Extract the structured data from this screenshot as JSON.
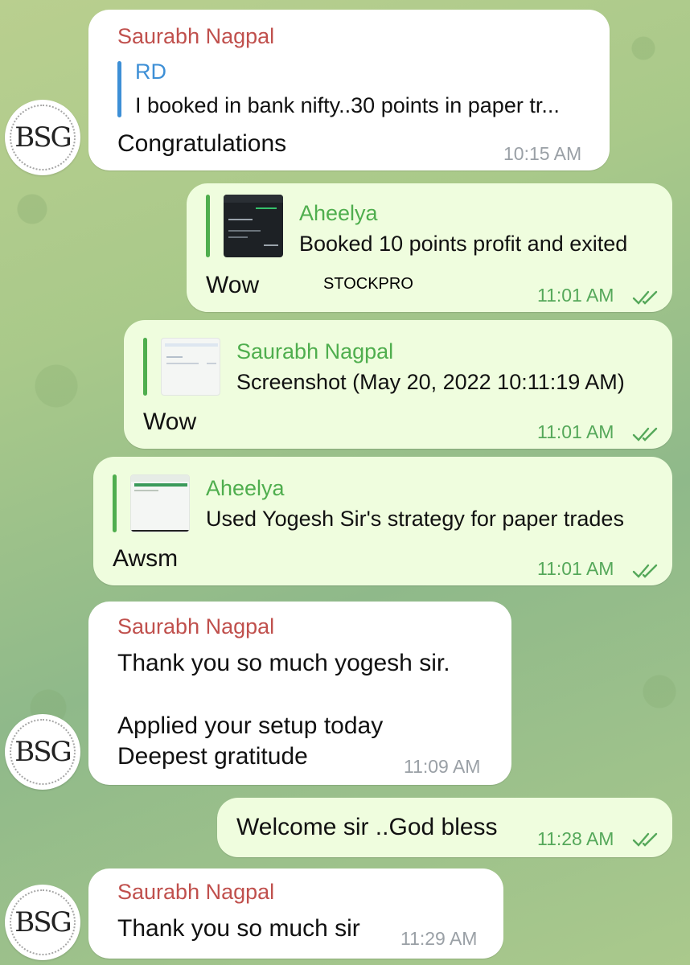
{
  "messages": [
    {
      "sender": "Saurabh Nagpal",
      "reply_to": {
        "author": "RD",
        "text": "I booked in bank nifty..30 points in paper tr..."
      },
      "text": "Congratulations",
      "time": "10:15 AM"
    },
    {
      "reply_to": {
        "author": "Aheelya",
        "text": "Booked 10 points profit and exited"
      },
      "text": "Wow",
      "time": "11:01 AM"
    },
    {
      "reply_to": {
        "author": "Saurabh Nagpal",
        "text": "Screenshot (May 20, 2022 10:11:19 AM)"
      },
      "text": "Wow",
      "time": "11:01 AM"
    },
    {
      "reply_to": {
        "author": "Aheelya",
        "text": "Used Yogesh Sir's strategy for paper trades"
      },
      "text": "Awsm",
      "time": "11:01 AM"
    },
    {
      "sender": "Saurabh Nagpal",
      "lines": [
        "Thank you so much yogesh sir.",
        "",
        "Applied your setup today",
        "Deepest gratitude"
      ],
      "time": "11:09 AM"
    },
    {
      "text": "Welcome sir ..God bless",
      "time": "11:28 AM"
    },
    {
      "sender": "Saurabh Nagpal",
      "text": "Thank you so much sir",
      "time": "11:29 AM"
    }
  ],
  "avatar_text": "BSG",
  "watermark": "STOCKPRO",
  "colors": {
    "incoming_bubble": "#ffffff",
    "outgoing_bubble": "#effdde",
    "sender_name": "#c0504d",
    "reply_green": "#4fae4e",
    "reply_blue": "#3d8fd6",
    "outgoing_time": "#55a85a"
  }
}
